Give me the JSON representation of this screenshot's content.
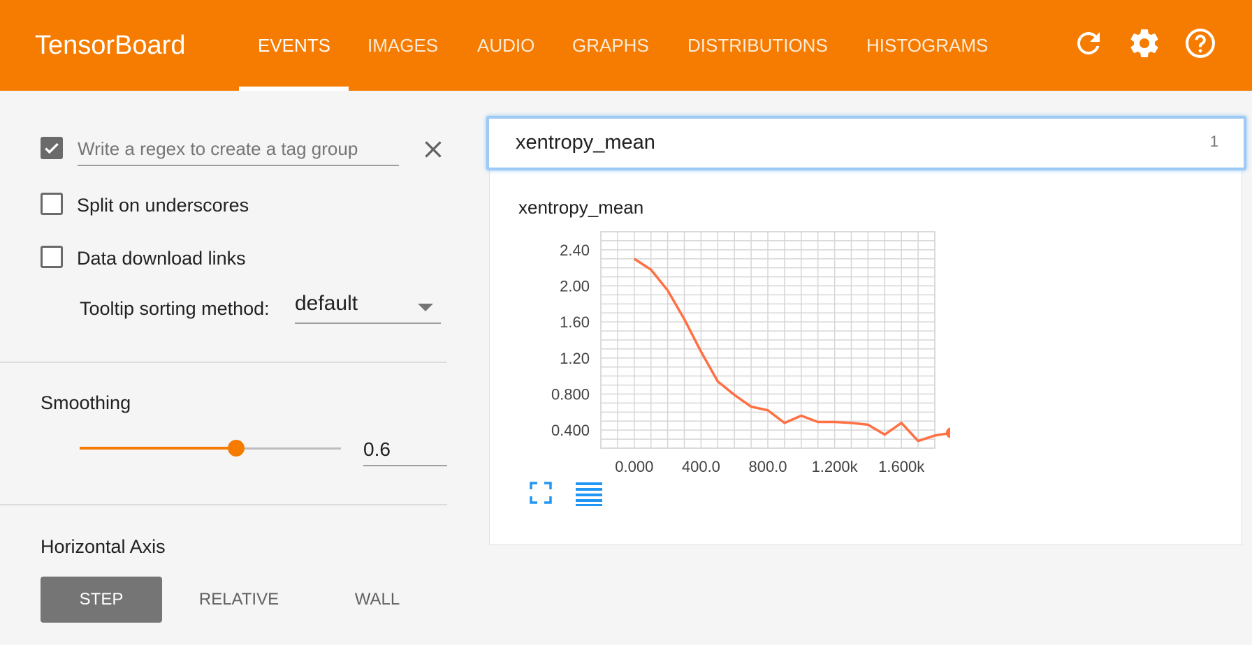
{
  "app": {
    "title": "TensorBoard",
    "tabs": [
      "EVENTS",
      "IMAGES",
      "AUDIO",
      "GRAPHS",
      "DISTRIBUTIONS",
      "HISTOGRAMS"
    ],
    "active_tab": "EVENTS",
    "accent_color": "#f57c00",
    "toolbar_icons": [
      "refresh-icon",
      "settings-icon",
      "help-icon"
    ]
  },
  "sidebar": {
    "regex_enabled": true,
    "regex_placeholder": "Write a regex to create a tag group",
    "split_underscores_label": "Split on underscores",
    "split_underscores_checked": false,
    "download_links_label": "Data download links",
    "download_links_checked": false,
    "tooltip_label": "Tooltip sorting method:",
    "tooltip_value": "default",
    "smoothing_label": "Smoothing",
    "smoothing_value": "0.6",
    "smoothing_fraction": 0.6,
    "horizontal_axis_label": "Horizontal Axis",
    "axis_options": [
      "STEP",
      "RELATIVE",
      "WALL"
    ],
    "axis_selected": "STEP"
  },
  "pane": {
    "header_title": "xentropy_mean",
    "header_count": "1",
    "card_icons": [
      "fullscreen-icon",
      "data-table-icon"
    ]
  },
  "chart_data": {
    "type": "line",
    "title": "xentropy_mean",
    "x_tick_labels": [
      "0.000",
      "400.0",
      "800.0",
      "1.200k",
      "1.600k"
    ],
    "y_tick_labels": [
      "2.40",
      "2.00",
      "1.60",
      "1.20",
      "0.800",
      "0.400"
    ],
    "xlim": [
      -200,
      1800
    ],
    "ylim": [
      0.2,
      2.6
    ],
    "grid": true,
    "series": [
      {
        "color": "#ff7043",
        "x": [
          0,
          100,
          200,
          300,
          400,
          500,
          600,
          700,
          800,
          900,
          1000,
          1100,
          1200,
          1300,
          1400,
          1500,
          1600,
          1700,
          1800,
          1900
        ],
        "y": [
          2.3,
          2.18,
          1.95,
          1.63,
          1.27,
          0.94,
          0.79,
          0.66,
          0.62,
          0.48,
          0.56,
          0.49,
          0.49,
          0.48,
          0.46,
          0.35,
          0.48,
          0.28,
          0.34,
          0.37
        ]
      }
    ]
  }
}
